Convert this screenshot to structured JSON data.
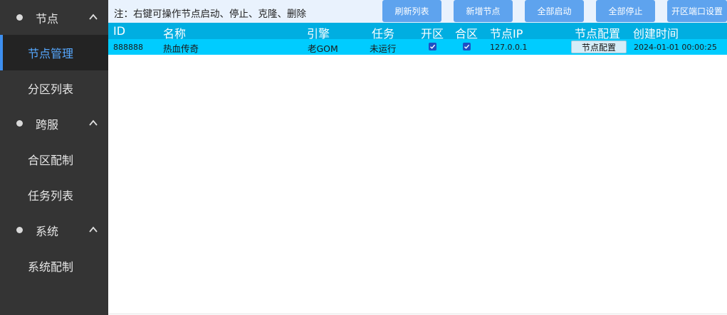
{
  "sidebar": {
    "groups": [
      {
        "label": "节点",
        "items": [
          "节点管理",
          "分区列表"
        ]
      },
      {
        "label": "跨服",
        "items": [
          "合区配制",
          "任务列表"
        ]
      },
      {
        "label": "系统",
        "items": [
          "系统配制"
        ]
      }
    ],
    "active_item": "节点管理",
    "colors": {
      "background": "#343434",
      "active_background": "#232323",
      "active_text": "#56a8ff"
    }
  },
  "topbar": {
    "notice": "注：右键可操作节点启动、停止、克隆、删除",
    "buttons": [
      "刷新列表",
      "新增节点",
      "全部启动",
      "全部停止",
      "开区端口设置"
    ]
  },
  "table": {
    "columns": [
      "ID",
      "名称",
      "引擎",
      "任务",
      "开区",
      "合区",
      "节点IP",
      "节点配置",
      "创建时间"
    ],
    "rows": [
      {
        "id": "888888",
        "name": "热血传奇",
        "engine": "老GOM",
        "task": "未运行",
        "open_zone": true,
        "merge_zone": true,
        "ip": "127.0.0.1",
        "config_button": "节点配置",
        "created": "2024-01-01 00:00:25"
      }
    ],
    "colors": {
      "header": "#00aee1",
      "row": "#00ccff",
      "checkbox": "#1f4fc4"
    }
  }
}
